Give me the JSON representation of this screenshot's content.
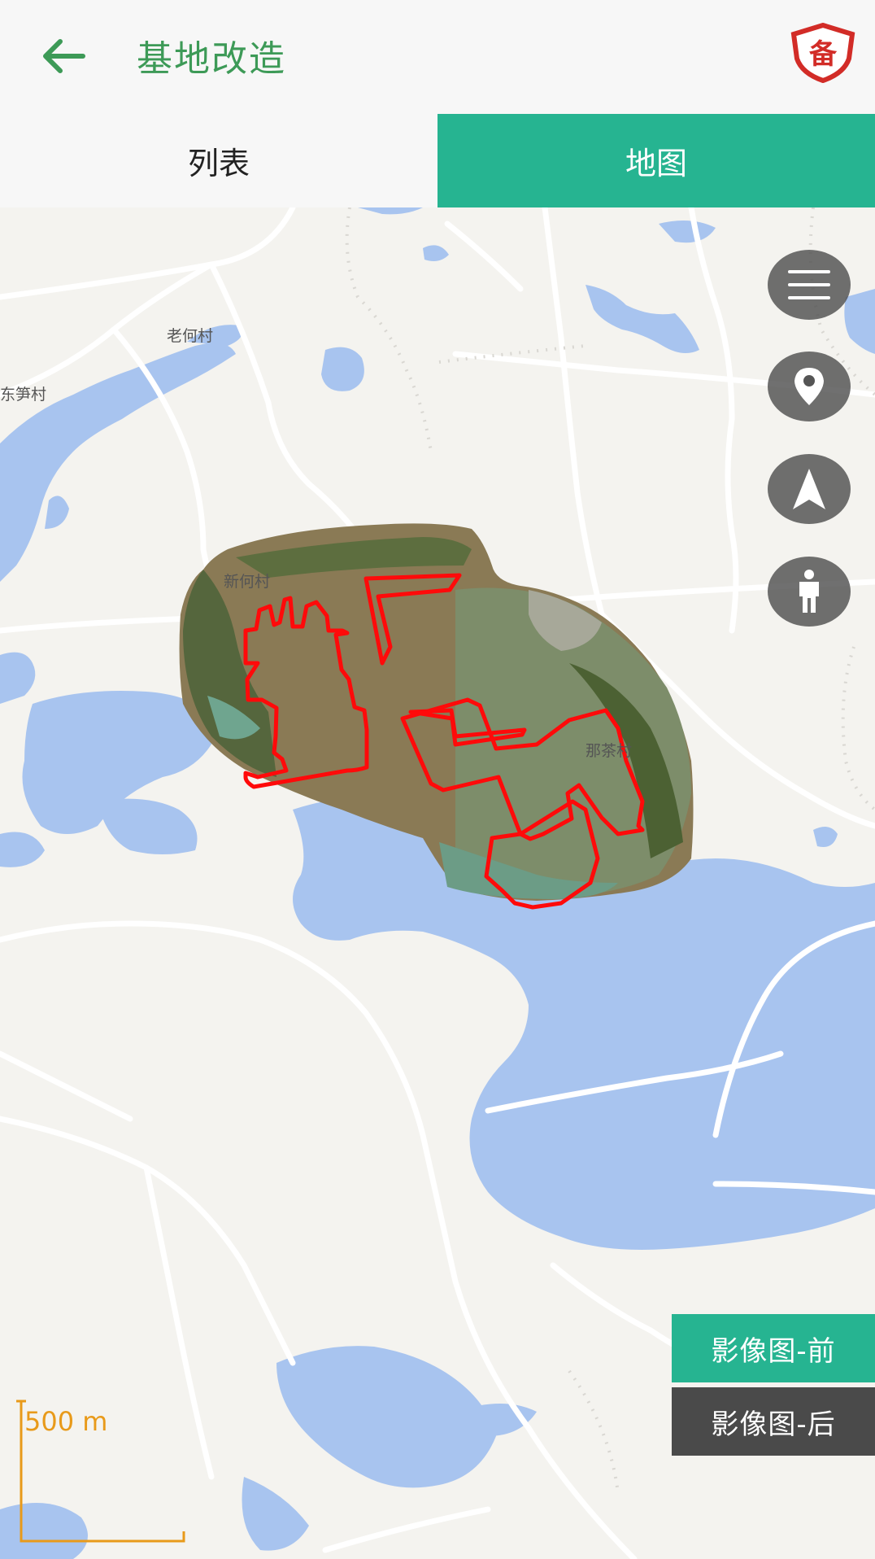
{
  "header": {
    "title": "基地改造",
    "back_icon": "arrow-left-icon",
    "badge_icon": "备",
    "title_color": "#3d9a57"
  },
  "tabs": [
    {
      "label": "列表",
      "active": false
    },
    {
      "label": "地图",
      "active": true
    }
  ],
  "accent": "#26b491",
  "map": {
    "villages": [
      "老何村",
      "东笋村",
      "新何村",
      "那茶村"
    ],
    "controls": [
      "menu-icon",
      "location-pin-icon",
      "navigation-arrow-icon",
      "person-icon"
    ],
    "scale_label": "500 m"
  },
  "imagery_buttons": {
    "before": "影像图-前",
    "after": "影像图-后"
  }
}
